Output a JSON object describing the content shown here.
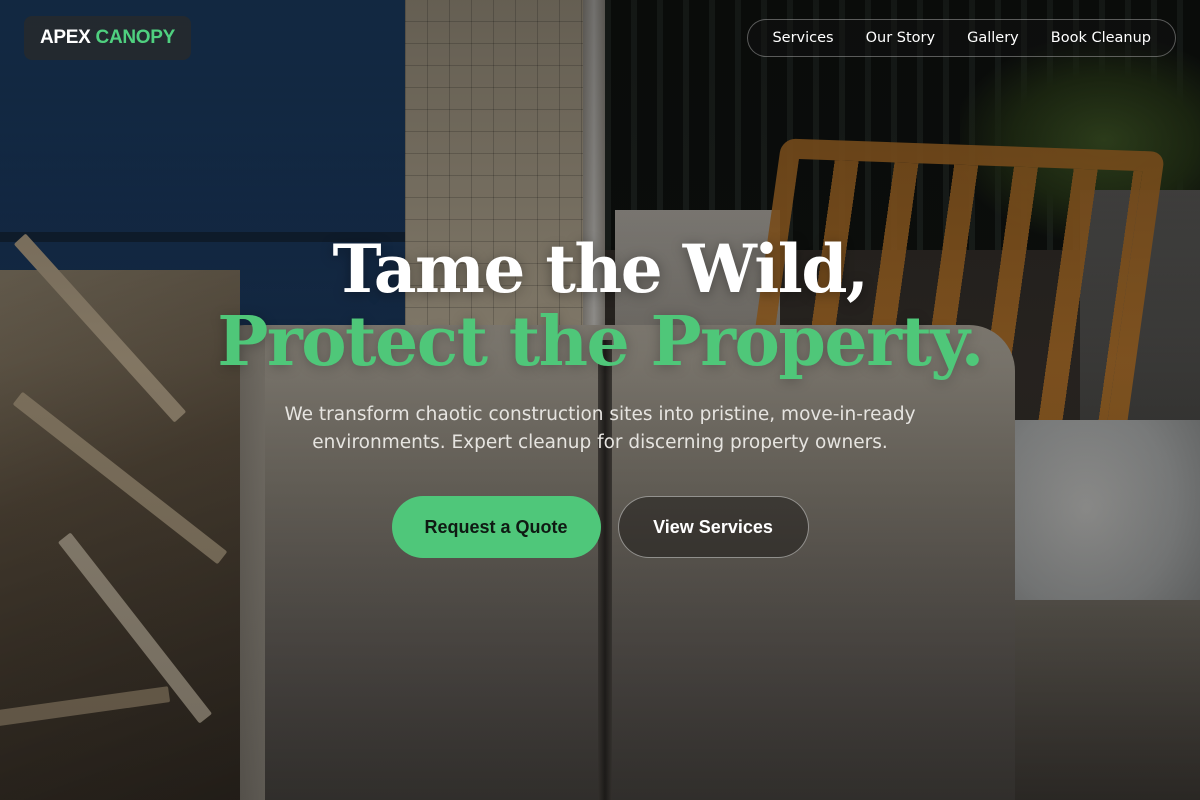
{
  "brand": {
    "word1": "APEX",
    "word2": "CANOPY",
    "accent_color": "#4fd07f"
  },
  "nav": {
    "items": [
      {
        "label": "Services"
      },
      {
        "label": "Our Story"
      },
      {
        "label": "Gallery"
      },
      {
        "label": "Book Cleanup"
      }
    ]
  },
  "hero": {
    "title_line1": "Tame the Wild,",
    "title_line2": "Protect the Property.",
    "subtitle": "We transform chaotic construction sites into pristine, move-in-ready environments. Expert cleanup for discerning property owners.",
    "primary_cta": "Request a Quote",
    "secondary_cta": "View Services",
    "accent_color": "#4fc779"
  }
}
